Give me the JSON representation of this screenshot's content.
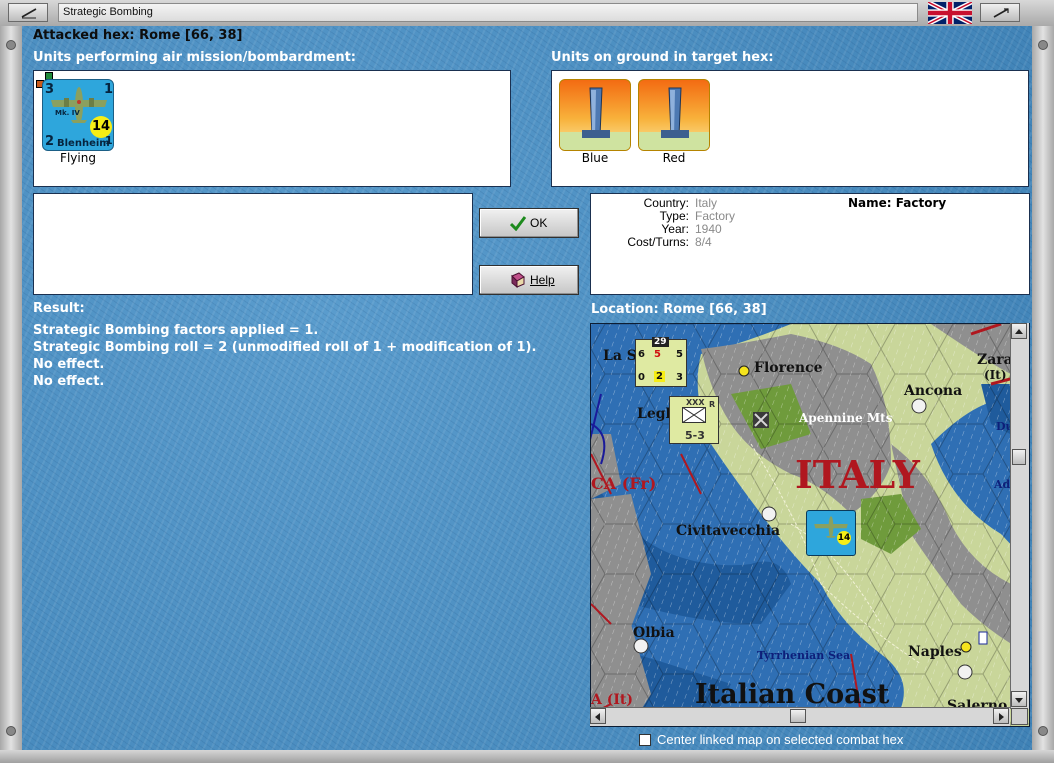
{
  "window": {
    "title": "Strategic Bombing"
  },
  "header": {
    "attacked_hex": "Attacked hex: Rome  [66, 38]"
  },
  "attackers": {
    "label": "Units performing air mission/bombardment:",
    "units": [
      {
        "name": "Blenheim",
        "mark": "Mk. IV",
        "top_left": "3",
        "top_right": "1",
        "bottom_left": "2",
        "bottom_right": "1",
        "range": "14",
        "status": "Flying"
      }
    ]
  },
  "targets": {
    "label": "Units on ground in target hex:",
    "units": [
      {
        "caption": "Blue"
      },
      {
        "caption": "Red"
      }
    ]
  },
  "buttons": {
    "ok": "OK",
    "help": "Help"
  },
  "target_info": {
    "country_label": "Country:",
    "country": "Italy",
    "type_label": "Type:",
    "type": "Factory",
    "year_label": "Year:",
    "year": "1940",
    "cost_label": "Cost/Turns:",
    "cost": "8/4",
    "name_label": "Name: Factory"
  },
  "result": {
    "label": "Result:",
    "lines": [
      "Strategic Bombing factors applied = 1.",
      "Strategic Bombing roll = 2 (unmodified roll of 1 + modification of 1).",
      "No effect.",
      "No effect."
    ]
  },
  "location": {
    "label": "Location:  Rome  [66, 38]"
  },
  "map": {
    "labels": {
      "florence": "Florence",
      "ancona": "Ancona",
      "apennine": "Apennine Mts",
      "italy": "ITALY",
      "civitavecchia": "Civitavecchia",
      "olbia": "Olbia",
      "tyrrhenian": "Tyrrhenian Sea",
      "naples": "Naples",
      "coast": "Italian Coast",
      "salerno": "Salerno",
      "zara": "Zara",
      "zara_it": "(It)",
      "la_s": "La S",
      "legh": "Legh",
      "ca_fr": "CA (Fr)",
      "a_it": "A (It)",
      "du": "Du",
      "ad": "Ad"
    },
    "stack_a": {
      "top": "29",
      "tl": "6",
      "tm": "5",
      "tr": "5",
      "bl": "0",
      "bm": "2",
      "br": "3"
    },
    "stack_b": {
      "xxx": "XXX",
      "r": "R",
      "bottom": "5-3"
    },
    "bomber": {
      "range": "14"
    }
  },
  "checkbox": {
    "label": "Center linked map on selected combat hex",
    "checked": false
  },
  "colors": {
    "background": "#4a8fc2",
    "sea": "#2f6fb4",
    "land": "#c9d69a",
    "mountains": "#8f8f8f",
    "italy_label": "#b0171f"
  }
}
